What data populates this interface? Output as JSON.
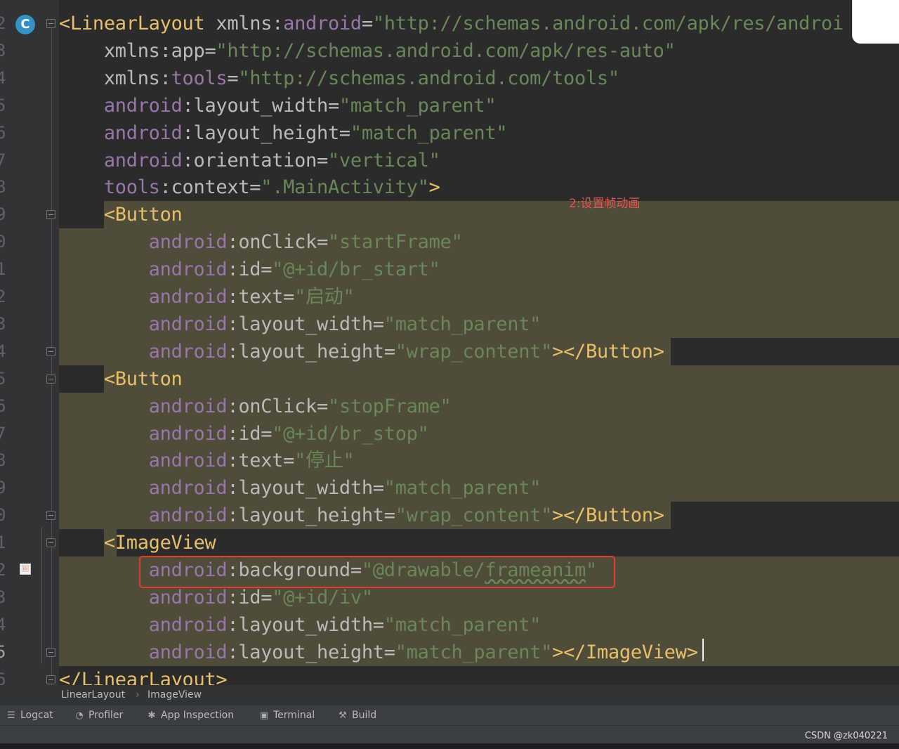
{
  "editor": {
    "lines": [
      {
        "num": "2",
        "segs": [
          {
            "t": "<",
            "c": "tag"
          },
          {
            "t": "LinearLayout ",
            "c": "tag"
          },
          {
            "t": "xmlns",
            "c": "attr"
          },
          {
            "t": ":",
            "c": "attr"
          },
          {
            "t": "android",
            "c": "ns"
          },
          {
            "t": "=",
            "c": "attr"
          },
          {
            "t": "\"http://schemas.android.com/apk/res/androi",
            "c": "val"
          }
        ]
      },
      {
        "num": "3",
        "segs": [
          {
            "t": "    "
          },
          {
            "t": "xmlns",
            "c": "attr"
          },
          {
            "t": ":",
            "c": "attr"
          },
          {
            "t": "app",
            "c": "attr"
          },
          {
            "t": "=",
            "c": "attr"
          },
          {
            "t": "\"http://schemas.android.com/apk/res-auto\"",
            "c": "val"
          }
        ]
      },
      {
        "num": "4",
        "segs": [
          {
            "t": "    "
          },
          {
            "t": "xmlns",
            "c": "attr"
          },
          {
            "t": ":",
            "c": "attr"
          },
          {
            "t": "tools",
            "c": "ns"
          },
          {
            "t": "=",
            "c": "attr"
          },
          {
            "t": "\"http://schemas.android.com/tools\"",
            "c": "val"
          }
        ]
      },
      {
        "num": "5",
        "segs": [
          {
            "t": "    "
          },
          {
            "t": "android",
            "c": "ns"
          },
          {
            "t": ":layout_width",
            "c": "attr"
          },
          {
            "t": "=",
            "c": "attr"
          },
          {
            "t": "\"match_parent\"",
            "c": "val"
          }
        ]
      },
      {
        "num": "6",
        "segs": [
          {
            "t": "    "
          },
          {
            "t": "android",
            "c": "ns"
          },
          {
            "t": ":layout_height",
            "c": "attr"
          },
          {
            "t": "=",
            "c": "attr"
          },
          {
            "t": "\"match_parent\"",
            "c": "val"
          }
        ]
      },
      {
        "num": "7",
        "segs": [
          {
            "t": "    "
          },
          {
            "t": "android",
            "c": "ns"
          },
          {
            "t": ":orientation",
            "c": "attr"
          },
          {
            "t": "=",
            "c": "attr"
          },
          {
            "t": "\"vertical\"",
            "c": "val"
          }
        ]
      },
      {
        "num": "8",
        "segs": [
          {
            "t": "    "
          },
          {
            "t": "tools",
            "c": "ns"
          },
          {
            "t": ":context",
            "c": "attr"
          },
          {
            "t": "=",
            "c": "attr"
          },
          {
            "t": "\".MainActivity\"",
            "c": "val"
          },
          {
            "t": ">",
            "c": "tag"
          }
        ]
      },
      {
        "num": "9",
        "segs": [
          {
            "t": "    "
          },
          {
            "t": "<Button",
            "c": "tag"
          }
        ]
      },
      {
        "num": "0",
        "segs": [
          {
            "t": "        "
          },
          {
            "t": "android",
            "c": "ns"
          },
          {
            "t": ":onClick",
            "c": "attr"
          },
          {
            "t": "=",
            "c": "attr"
          },
          {
            "t": "\"startFrame\"",
            "c": "val"
          }
        ]
      },
      {
        "num": "1",
        "segs": [
          {
            "t": "        "
          },
          {
            "t": "android",
            "c": "ns"
          },
          {
            "t": ":id",
            "c": "attr"
          },
          {
            "t": "=",
            "c": "attr"
          },
          {
            "t": "\"@+id/br_start\"",
            "c": "val"
          }
        ]
      },
      {
        "num": "2",
        "segs": [
          {
            "t": "        "
          },
          {
            "t": "android",
            "c": "ns"
          },
          {
            "t": ":text",
            "c": "attr"
          },
          {
            "t": "=",
            "c": "attr"
          },
          {
            "t": "\"启动\"",
            "c": "val"
          }
        ]
      },
      {
        "num": "3",
        "segs": [
          {
            "t": "        "
          },
          {
            "t": "android",
            "c": "ns"
          },
          {
            "t": ":layout_width",
            "c": "attr"
          },
          {
            "t": "=",
            "c": "attr"
          },
          {
            "t": "\"match_parent\"",
            "c": "val"
          }
        ]
      },
      {
        "num": "4",
        "segs": [
          {
            "t": "        "
          },
          {
            "t": "android",
            "c": "ns"
          },
          {
            "t": ":layout_height",
            "c": "attr"
          },
          {
            "t": "=",
            "c": "attr"
          },
          {
            "t": "\"wrap_content\"",
            "c": "val"
          },
          {
            "t": "></Button>",
            "c": "tag"
          }
        ]
      },
      {
        "num": "5",
        "segs": [
          {
            "t": "    "
          },
          {
            "t": "<Button",
            "c": "tag"
          }
        ]
      },
      {
        "num": "6",
        "segs": [
          {
            "t": "        "
          },
          {
            "t": "android",
            "c": "ns"
          },
          {
            "t": ":onClick",
            "c": "attr"
          },
          {
            "t": "=",
            "c": "attr"
          },
          {
            "t": "\"stopFrame\"",
            "c": "val"
          }
        ]
      },
      {
        "num": "7",
        "segs": [
          {
            "t": "        "
          },
          {
            "t": "android",
            "c": "ns"
          },
          {
            "t": ":id",
            "c": "attr"
          },
          {
            "t": "=",
            "c": "attr"
          },
          {
            "t": "\"@+id/br_stop\"",
            "c": "val"
          }
        ]
      },
      {
        "num": "8",
        "segs": [
          {
            "t": "        "
          },
          {
            "t": "android",
            "c": "ns"
          },
          {
            "t": ":text",
            "c": "attr"
          },
          {
            "t": "=",
            "c": "attr"
          },
          {
            "t": "\"停止\"",
            "c": "val"
          }
        ]
      },
      {
        "num": "9",
        "segs": [
          {
            "t": "        "
          },
          {
            "t": "android",
            "c": "ns"
          },
          {
            "t": ":layout_width",
            "c": "attr"
          },
          {
            "t": "=",
            "c": "attr"
          },
          {
            "t": "\"match_parent\"",
            "c": "val"
          }
        ]
      },
      {
        "num": "0",
        "segs": [
          {
            "t": "        "
          },
          {
            "t": "android",
            "c": "ns"
          },
          {
            "t": ":layout_height",
            "c": "attr"
          },
          {
            "t": "=",
            "c": "attr"
          },
          {
            "t": "\"wrap_content\"",
            "c": "val"
          },
          {
            "t": "></Button>",
            "c": "tag"
          }
        ]
      },
      {
        "num": "1",
        "segs": [
          {
            "t": "    "
          },
          {
            "t": "<ImageView",
            "c": "tag"
          }
        ]
      },
      {
        "num": "2",
        "segs": [
          {
            "t": "        "
          },
          {
            "t": "android",
            "c": "ns"
          },
          {
            "t": ":background",
            "c": "attr"
          },
          {
            "t": "=",
            "c": "attr"
          },
          {
            "t": "\"@drawable/",
            "c": "val"
          },
          {
            "t": "frameanim",
            "c": "val squig"
          },
          {
            "t": "\"",
            "c": "val"
          }
        ]
      },
      {
        "num": "3",
        "segs": [
          {
            "t": "        "
          },
          {
            "t": "android",
            "c": "ns"
          },
          {
            "t": ":id",
            "c": "attr"
          },
          {
            "t": "=",
            "c": "attr"
          },
          {
            "t": "\"@+id/iv\"",
            "c": "val"
          }
        ]
      },
      {
        "num": "4",
        "segs": [
          {
            "t": "        "
          },
          {
            "t": "android",
            "c": "ns"
          },
          {
            "t": ":layout_width",
            "c": "attr"
          },
          {
            "t": "=",
            "c": "attr"
          },
          {
            "t": "\"match_parent\"",
            "c": "val"
          }
        ]
      },
      {
        "num": "5",
        "segs": [
          {
            "t": "        "
          },
          {
            "t": "android",
            "c": "ns"
          },
          {
            "t": ":layout_height",
            "c": "attr"
          },
          {
            "t": "=",
            "c": "attr"
          },
          {
            "t": "\"match_parent\"",
            "c": "val"
          },
          {
            "t": "></ImageView>",
            "c": "tag"
          }
        ]
      },
      {
        "num": "6",
        "segs": [
          {
            "t": "</LinearLayout>",
            "c": "tag"
          }
        ]
      }
    ],
    "gutter_icons": {
      "class_icon": "C",
      "image_icon": "🖼"
    }
  },
  "annotation": "2:设置帧动画",
  "breadcrumb": {
    "first": "LinearLayout",
    "separator": "›",
    "second": "ImageView"
  },
  "toolwindows": [
    {
      "label": "Logcat",
      "icon": "logcat-icon"
    },
    {
      "label": "Profiler",
      "icon": "profiler-icon"
    },
    {
      "label": "App Inspection",
      "icon": "app-inspection-icon"
    },
    {
      "label": "Terminal",
      "icon": "terminal-icon"
    },
    {
      "label": "Build",
      "icon": "build-icon"
    }
  ],
  "watermark": "CSDN @zk040221",
  "colors": {
    "tag": "#e8bf6a",
    "namespace": "#9876aa",
    "attribute": "#bababa",
    "value": "#6a8759",
    "highlight": "#4f4c39",
    "annotation": "#e2564f",
    "box": "#e53c30"
  }
}
